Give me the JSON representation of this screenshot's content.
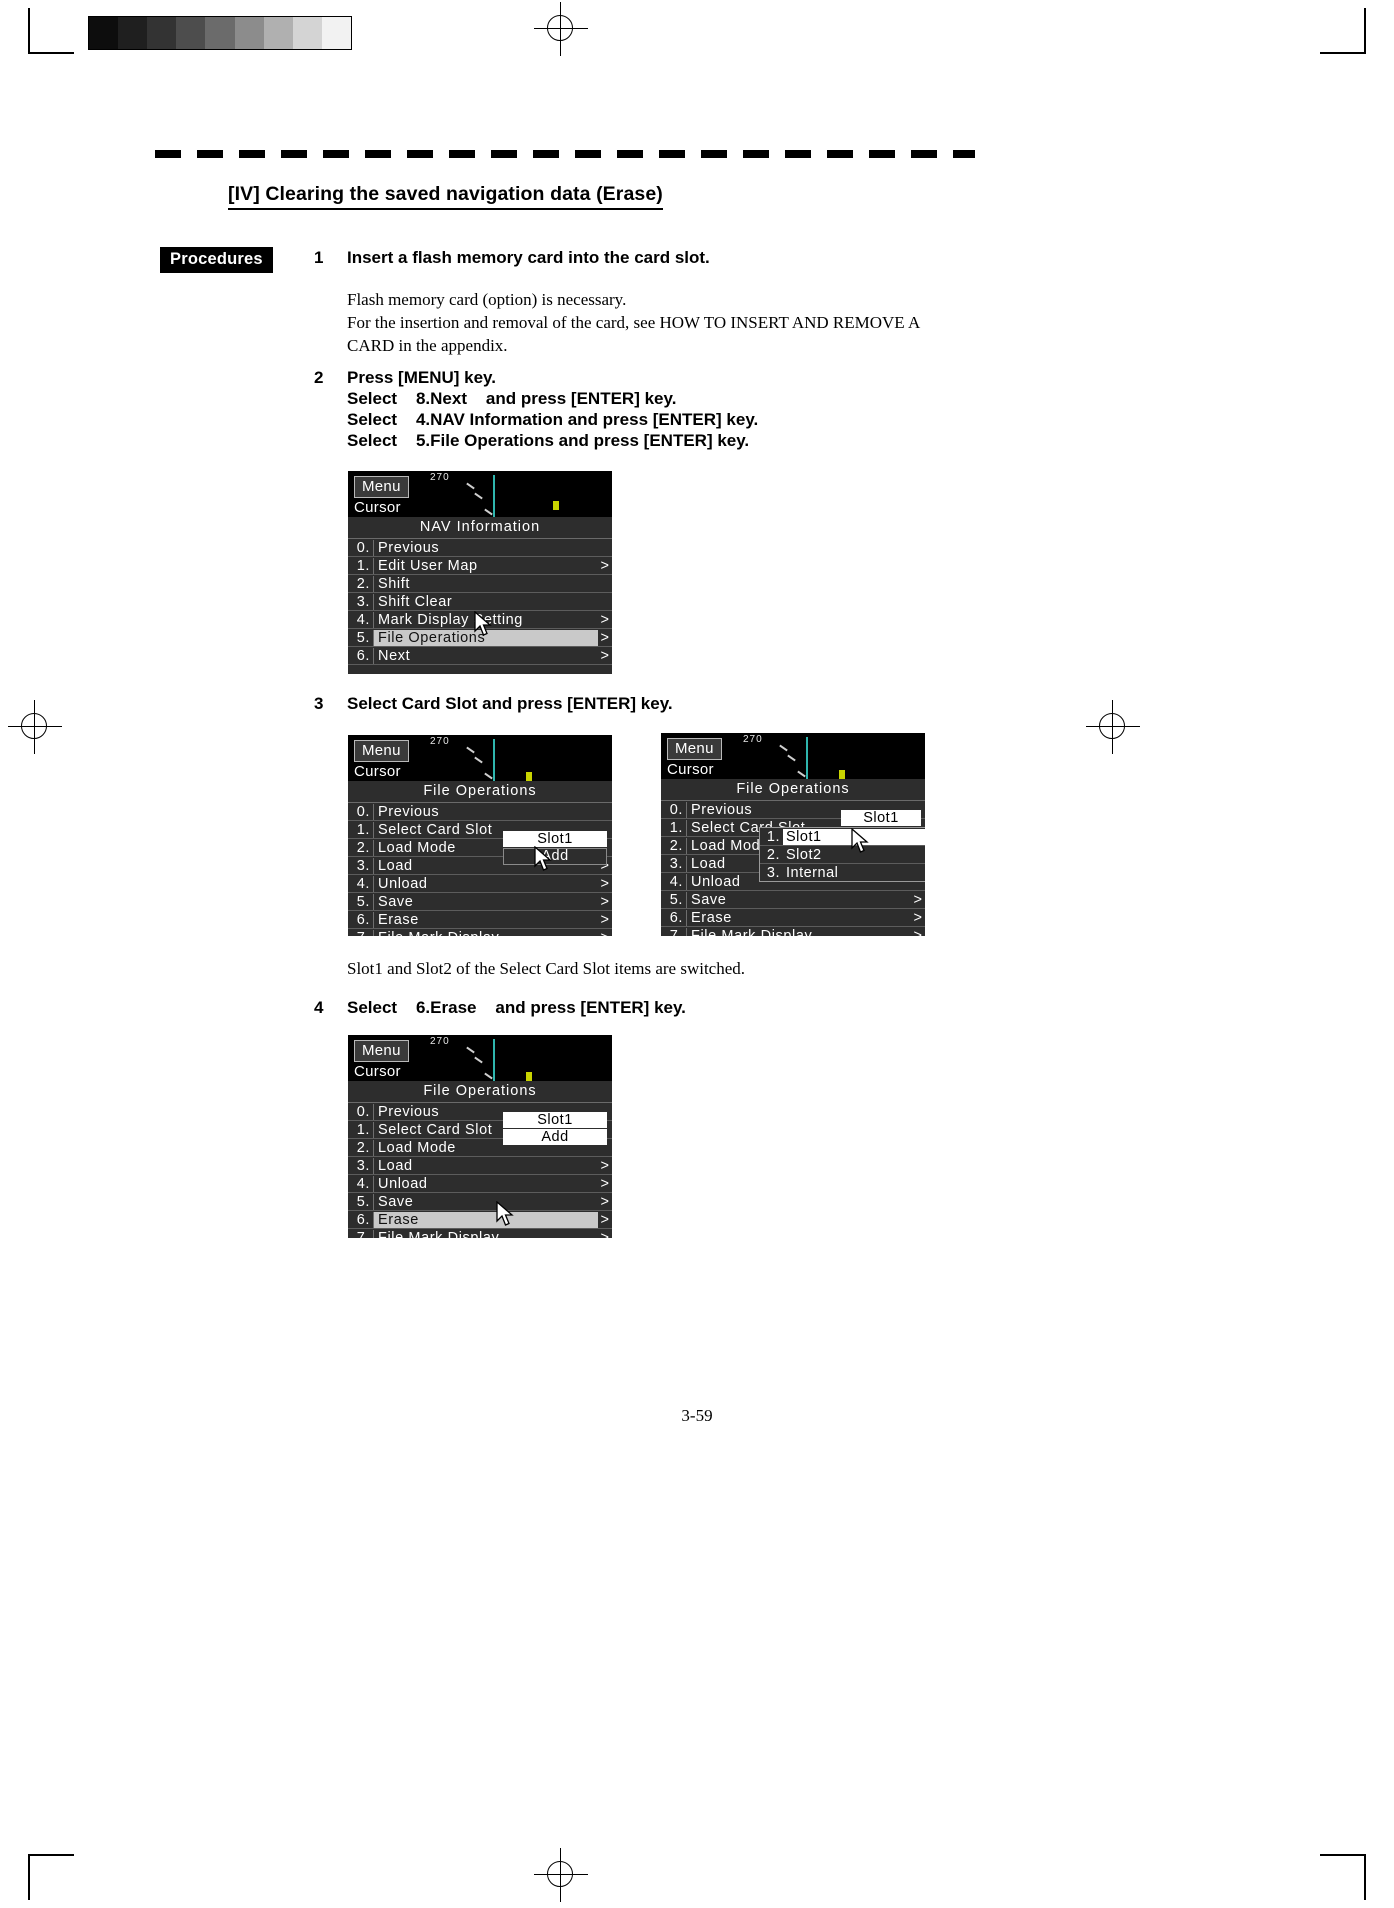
{
  "document": {
    "section_title": "[IV]    Clearing the saved navigation data (Erase)",
    "procedures_label": "Procedures",
    "page_number": "3-59"
  },
  "steps": [
    {
      "num": "1",
      "heading": "Insert a flash memory card into the card slot.",
      "body": "Flash memory card (option) is necessary.\nFor the insertion and removal of the card, see HOW TO INSERT AND REMOVE A\nCARD in the appendix."
    },
    {
      "num": "2",
      "heading": "Press [MENU] key.",
      "lines": [
        "Select    8.Next    and press [ENTER] key.",
        "Select    4.NAV Information and press [ENTER] key.",
        "Select    5.File Operations and press [ENTER] key."
      ]
    },
    {
      "num": "3",
      "heading": "Select Card Slot and press [ENTER] key.",
      "caption": "Slot1 and Slot2 of the Select Card Slot items are switched."
    },
    {
      "num": "4",
      "heading": "Select    6.Erase    and press [ENTER] key."
    }
  ],
  "lcd_screens": [
    {
      "id": "nav-information",
      "tab_label": "Menu",
      "cursor_label": "Cursor",
      "compass_label": "270",
      "menu_title": "NAV  Information",
      "rows": [
        {
          "idx": "0.",
          "label": "Previous",
          "arrow": "",
          "highlight": false
        },
        {
          "idx": "1.",
          "label": "Edit  User  Map",
          "arrow": ">",
          "highlight": false
        },
        {
          "idx": "2.",
          "label": "Shift",
          "arrow": "",
          "highlight": false
        },
        {
          "idx": "3.",
          "label": "Shift  Clear",
          "arrow": "",
          "highlight": false
        },
        {
          "idx": "4.",
          "label": "Mark  Display  Setting",
          "arrow": ">",
          "highlight": false
        },
        {
          "idx": "5.",
          "label": "File  Operations",
          "arrow": ">",
          "highlight": true
        },
        {
          "idx": "6.",
          "label": "Next",
          "arrow": ">",
          "highlight": false
        }
      ]
    },
    {
      "id": "file-operations-slot1",
      "tab_label": "Menu",
      "cursor_label": "Cursor",
      "compass_label": "270",
      "menu_title": "File  Operations",
      "rows": [
        {
          "idx": "0.",
          "label": "Previous",
          "arrow": "",
          "highlight": false
        },
        {
          "idx": "1.",
          "label": "Select  Card  Slot",
          "arrow": "",
          "highlight": false
        },
        {
          "idx": "2.",
          "label": "Load Mode",
          "arrow": "",
          "highlight": false
        },
        {
          "idx": "3.",
          "label": "Load",
          "arrow": ">",
          "highlight": false
        },
        {
          "idx": "4.",
          "label": "Unload",
          "arrow": ">",
          "highlight": false
        },
        {
          "idx": "5.",
          "label": "Save",
          "arrow": ">",
          "highlight": false
        },
        {
          "idx": "6.",
          "label": "Erase",
          "arrow": ">",
          "highlight": false
        },
        {
          "idx": "7.",
          "label": "File  Mark  Display",
          "arrow": ">",
          "highlight": false
        }
      ],
      "values": [
        {
          "row": 1,
          "text": "Slot1",
          "state": "selected"
        },
        {
          "row": 2,
          "text": "Add",
          "state": "unselected"
        }
      ]
    },
    {
      "id": "file-operations-slot-popup",
      "tab_label": "Menu",
      "cursor_label": "Cursor",
      "compass_label": "270",
      "menu_title": "File  Operations",
      "rows": [
        {
          "idx": "0.",
          "label": "Previous",
          "arrow": "",
          "highlight": false
        },
        {
          "idx": "1.",
          "label": "Select  Card  Slot",
          "arrow": "",
          "highlight": false
        },
        {
          "idx": "2.",
          "label": "Load  Mode",
          "arrow": "",
          "highlight": false
        },
        {
          "idx": "3.",
          "label": "Load",
          "arrow": "",
          "highlight": false
        },
        {
          "idx": "4.",
          "label": "Unload",
          "arrow": "",
          "highlight": false
        },
        {
          "idx": "5.",
          "label": "Save",
          "arrow": ">",
          "highlight": false
        },
        {
          "idx": "6.",
          "label": "Erase",
          "arrow": ">",
          "highlight": false
        },
        {
          "idx": "7.",
          "label": "File  Mark  Display",
          "arrow": ">",
          "highlight": false
        }
      ],
      "values": [
        {
          "row": 1,
          "text": "Slot1",
          "state": "selected"
        }
      ],
      "popup": {
        "options": [
          {
            "idx": "1.",
            "label": "Slot1",
            "selected": true
          },
          {
            "idx": "2.",
            "label": "Slot2",
            "selected": false
          },
          {
            "idx": "3.",
            "label": "Internal",
            "selected": false
          }
        ]
      }
    },
    {
      "id": "file-operations-erase",
      "tab_label": "Menu",
      "cursor_label": "Cursor",
      "compass_label": "270",
      "menu_title": "File  Operations",
      "rows": [
        {
          "idx": "0.",
          "label": "Previous",
          "arrow": "",
          "highlight": false
        },
        {
          "idx": "1.",
          "label": "Select  Card  Slot",
          "arrow": "",
          "highlight": false
        },
        {
          "idx": "2.",
          "label": "Load Mode",
          "arrow": "",
          "highlight": false
        },
        {
          "idx": "3.",
          "label": "Load",
          "arrow": ">",
          "highlight": false
        },
        {
          "idx": "4.",
          "label": "Unload",
          "arrow": ">",
          "highlight": false
        },
        {
          "idx": "5.",
          "label": "Save",
          "arrow": ">",
          "highlight": false
        },
        {
          "idx": "6.",
          "label": "Erase",
          "arrow": ">",
          "highlight": true
        },
        {
          "idx": "7.",
          "label": "File  Mark  Display",
          "arrow": ">",
          "highlight": false
        }
      ],
      "values": [
        {
          "row": 1,
          "text": "Slot1",
          "state": "selected"
        },
        {
          "row": 2,
          "text": "Add",
          "state": "selected"
        }
      ]
    }
  ],
  "greyscale_patches": [
    "#0d0d0d",
    "#1f1f1f",
    "#333333",
    "#4d4d4d",
    "#6b6b6b",
    "#8c8c8c",
    "#b0b0b0",
    "#d4d4d4",
    "#f2f2f2"
  ],
  "colors": {
    "ink": "#000000",
    "lcd_background": "#0a0a0a",
    "lcd_panel": "#2d2d2d",
    "lcd_highlight": "#c9c9c9",
    "lcd_accent_teal": "#2fb5ae",
    "lcd_buoy_yellow": "#c9d400"
  }
}
